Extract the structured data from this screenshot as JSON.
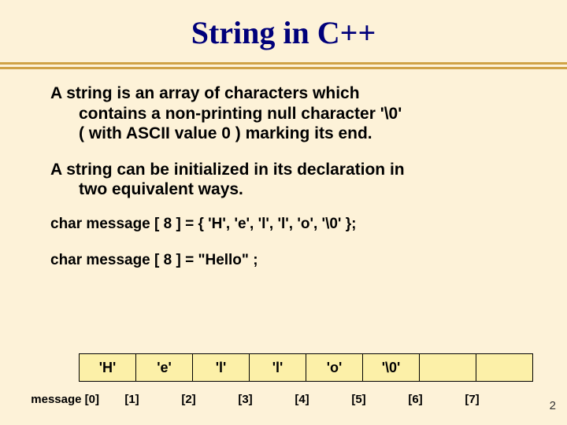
{
  "title": "String in C++",
  "para1_line1": "A string is an array of characters which",
  "para1_line2": "contains a non-printing null character '\\0'",
  "para1_line3": "( with ASCII value 0 ) marking its end.",
  "para2_line1": "A string can be initialized in its declaration in",
  "para2_line2": "two equivalent ways.",
  "code1": "char  message [ 8 ]  =  { 'H', 'e', 'l', 'l', 'o', '\\0' };",
  "code2": "char  message [ 8 ]  =  \"Hello\" ;",
  "chart_data": {
    "type": "table",
    "row_label": "message",
    "indices": [
      "[0]",
      "[1]",
      "[2]",
      "[3]",
      "[4]",
      "[5]",
      "[6]",
      "[7]"
    ],
    "cells": [
      "'H'",
      "'e'",
      "'l'",
      "'l'",
      "'o'",
      "'\\0'",
      "",
      ""
    ]
  },
  "page_number": "2"
}
